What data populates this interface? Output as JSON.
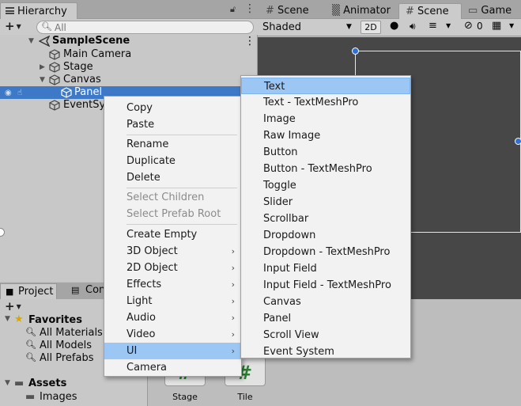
{
  "hierarchy": {
    "tab_label": "Hierarchy",
    "search_placeholder": "All",
    "scene_name": "SampleScene",
    "items": [
      {
        "label": "Main Camera"
      },
      {
        "label": "Stage"
      },
      {
        "label": "Canvas"
      },
      {
        "label": "Panel"
      },
      {
        "label": "EventSys"
      }
    ]
  },
  "scene": {
    "tabs": [
      "Scene",
      "Animator",
      "Scene",
      "Game"
    ],
    "shading_mode": "Shaded",
    "mode_2d": "2D",
    "hidden_count": "0"
  },
  "project": {
    "tab_label": "Project",
    "tab2_label": "Con",
    "favorites_label": "Favorites",
    "favorites": [
      "All Materials",
      "All Models",
      "All Prefabs"
    ],
    "assets_label": "Assets",
    "folders": [
      "Images"
    ],
    "grid_items": [
      "Stage",
      "Tile"
    ]
  },
  "context_menu": {
    "items": [
      "Copy",
      "Paste",
      "Rename",
      "Duplicate",
      "Delete",
      "Select Children",
      "Select Prefab Root",
      "Create Empty",
      "3D Object",
      "2D Object",
      "Effects",
      "Light",
      "Audio",
      "Video",
      "UI",
      "Camera"
    ],
    "submenu_arrow": "›"
  },
  "ui_submenu": {
    "items": [
      "Text",
      "Text - TextMeshPro",
      "Image",
      "Raw Image",
      "Button",
      "Button - TextMeshPro",
      "Toggle",
      "Slider",
      "Scrollbar",
      "Dropdown",
      "Dropdown - TextMeshPro",
      "Input Field",
      "Input Field - TextMeshPro",
      "Canvas",
      "Panel",
      "Scroll View",
      "Event System"
    ]
  },
  "colors": {
    "selection": "#3d79c7",
    "menu_highlight": "#9cc7f5",
    "scene_bg": "#474747"
  }
}
